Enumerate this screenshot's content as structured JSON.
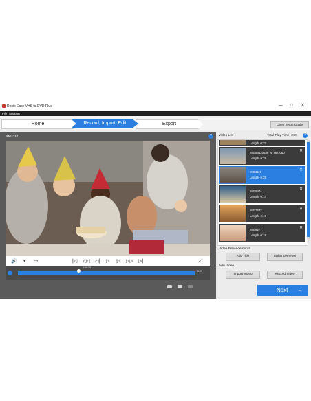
{
  "window": {
    "title": "Roxio Easy VHS to DVD Plus",
    "minimize": "—",
    "maximize": "□",
    "close": "✕"
  },
  "menu": {
    "file": "File",
    "support": "Support"
  },
  "steps": {
    "home": "Home",
    "current": "Record, Import, Edit",
    "export": "Export"
  },
  "setup_guide_label": "Open Setup Guide",
  "player": {
    "clip_name": "IMG1110",
    "help": "?",
    "timecode": "0:10:10",
    "end_time": "0:29",
    "controls": {
      "volume": "🔊",
      "menu": "▾",
      "aspect": "▭",
      "start": "|◁",
      "back": "◁◁",
      "prev": "◁|",
      "play": "▷",
      "next": "|▷",
      "fwd": "▷▷",
      "end": "▷|",
      "fullscreen": "⤢"
    }
  },
  "video_list": {
    "title": "Video List",
    "total_label": "Total Play Time: 2:21",
    "help": "?",
    "items": [
      {
        "name": "",
        "length": "Length: 0:??",
        "selected": false
      },
      {
        "name": "IMG84120536_V_HD1080",
        "length": "Length: 0:29",
        "selected": false
      },
      {
        "name": "IMG1110",
        "length": "Length: 0:29",
        "selected": true
      },
      {
        "name": "IMG5474",
        "length": "Length: 0:14",
        "selected": false
      },
      {
        "name": "IMG7532",
        "length": "Length: 0:40",
        "selected": false
      },
      {
        "name": "IMG6277",
        "length": "Length: 0:19",
        "selected": false
      }
    ],
    "close_glyph": "✕"
  },
  "enhancements": {
    "title": "Video Enhancements",
    "add_title": "Add Title",
    "enhancements": "Enhancements"
  },
  "add_video": {
    "title": "Add Video",
    "import": "Import Video",
    "record": "Record Video"
  },
  "next_label": "Next",
  "next_arrow": "→",
  "colors": {
    "accent": "#2a7fe0",
    "dark": "#3b3b3b",
    "panel": "#5a5a5a"
  }
}
